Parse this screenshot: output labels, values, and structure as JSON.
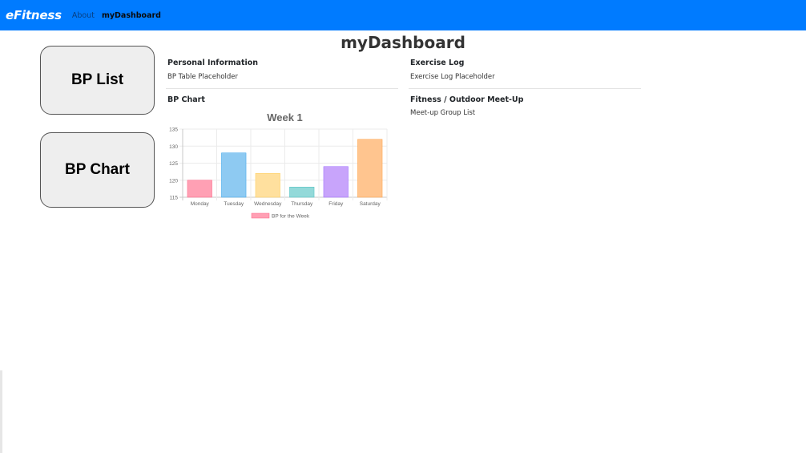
{
  "navbar": {
    "brand": "eFitness",
    "links": [
      {
        "label": "About",
        "active": false
      },
      {
        "label": "myDashboard",
        "active": true
      }
    ],
    "color": "#007bff"
  },
  "page": {
    "title": "myDashboard"
  },
  "buttons": {
    "bp_list": "BP List",
    "bp_chart": "BP Chart"
  },
  "cards": {
    "personal_info": {
      "title": "Personal Information",
      "body": "BP Table Placeholder"
    },
    "bp_chart": {
      "title": "BP Chart"
    },
    "exercise_log": {
      "title": "Exercise Log",
      "body": "Exercise Log Placeholder"
    },
    "meetup": {
      "title": "Fitness / Outdoor Meet-Up",
      "body": "Meet-up Group List"
    }
  },
  "chart_data": {
    "type": "bar",
    "title": "Week 1",
    "categories": [
      "Monday",
      "Tuesday",
      "Wednesday",
      "Thursday",
      "Friday",
      "Saturday"
    ],
    "series": [
      {
        "name": "BP for the Week",
        "values": [
          120,
          128,
          122,
          118,
          124,
          132
        ]
      }
    ],
    "ylim": [
      115,
      135
    ],
    "yticks": [
      115,
      120,
      125,
      130,
      135
    ],
    "grid": true,
    "legend": "bottom",
    "bar_fill_colors": [
      "#ffa0b4",
      "#8ecaf2",
      "#ffe09e",
      "#93d9d9",
      "#c8a4fb",
      "#ffc58f"
    ],
    "bar_stroke_colors": [
      "#ff6384",
      "#36a2eb",
      "#ffcd56",
      "#4bc0c0",
      "#9966ff",
      "#ff9f40"
    ]
  }
}
